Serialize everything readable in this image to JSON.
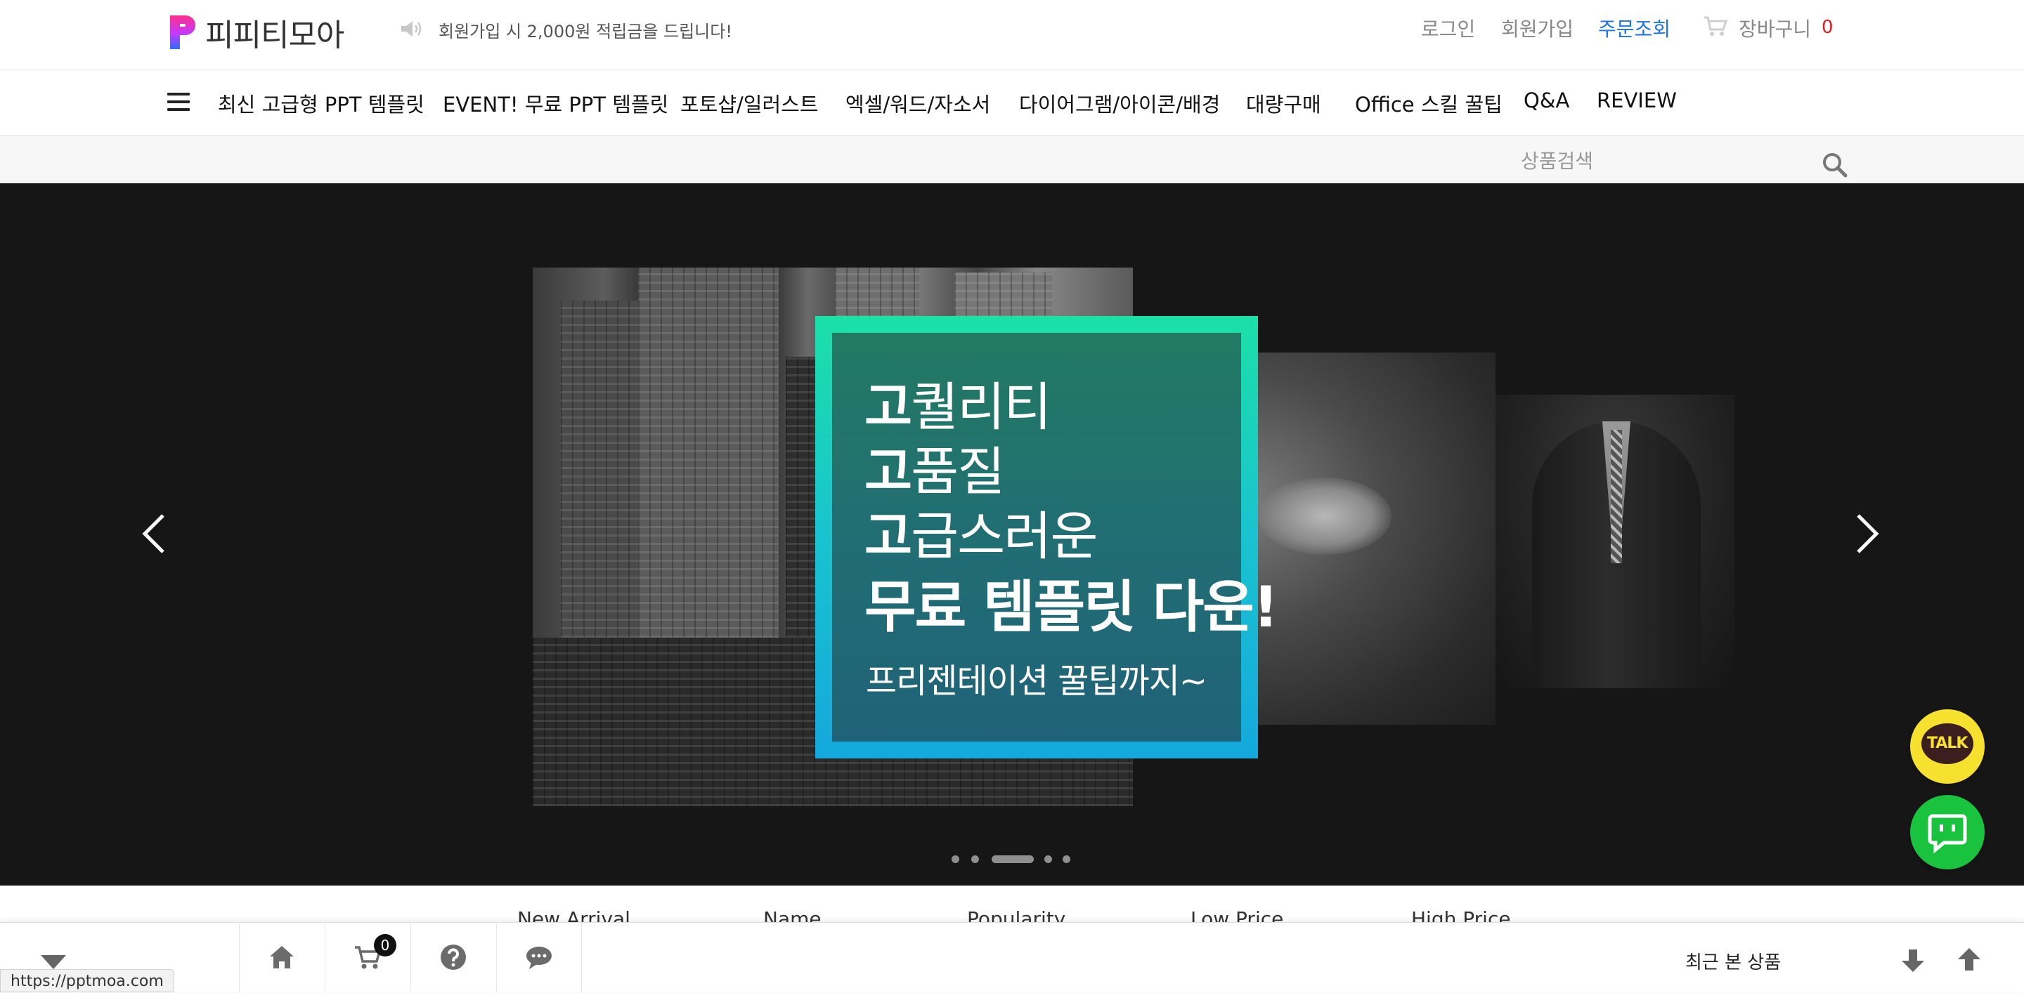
{
  "header": {
    "brand": "피피티모아",
    "notice": "회원가입 시 2,000원 적립금을 드립니다!",
    "links": {
      "login": "로그인",
      "join": "회원가입",
      "order": "주문조회",
      "cart": "장바구니"
    },
    "cart_count": "0",
    "colors": {
      "accent": "#1a73e8",
      "badge": "#e02020",
      "logo_top": "#e33bb0",
      "logo_bottom": "#2f6bff"
    }
  },
  "nav": {
    "items": [
      "최신 고급형 PPT 템플릿",
      "EVENT! 무료 PPT 템플릿",
      "포토샵/일러스트",
      "엑셀/워드/자소서",
      "다이어그램/아이콘/배경",
      "대량구매",
      "Office 스킬 꿀팁",
      "Q&A",
      "REVIEW"
    ]
  },
  "search": {
    "placeholder": "상품검색"
  },
  "hero": {
    "line1_bold": "고",
    "line1_rest": "퀄리티",
    "line2_bold": "고",
    "line2_rest": "품질",
    "line3_bold": "고",
    "line3_rest": "급스러운",
    "line4": "무료 템플릿 다운!",
    "sub": "프리젠테이션 꿀팁까지~",
    "slide_count": 5,
    "active_slide": 3,
    "frame_colors": [
      "#1be0a8",
      "#14a8dc"
    ]
  },
  "sort": [
    "New Arrival",
    "Name",
    "Popularity",
    "Low Price",
    "High Price"
  ],
  "floating": {
    "talk": "TALK"
  },
  "bottom": {
    "cart_badge": "0",
    "recent": "최근 본 상품",
    "icons": [
      "home-icon",
      "cart-icon",
      "help-icon",
      "chat-icon"
    ]
  },
  "status_url": "https://pptmoa.com"
}
